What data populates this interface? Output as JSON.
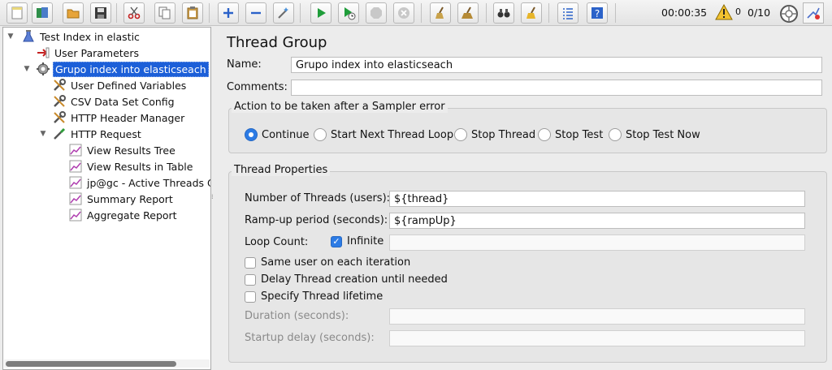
{
  "toolbar": {
    "buttons": [
      "new",
      "templates",
      "open",
      "save",
      "cut",
      "copy",
      "paste",
      "expand",
      "collapse",
      "toggle",
      "start",
      "start-no-pauses",
      "stop",
      "shutdown",
      "clear",
      "clear-all",
      "search",
      "reset-search",
      "function-helper",
      "help"
    ],
    "elapsed_time": "00:00:35",
    "error_count": "0",
    "thread_ratio": "0/10"
  },
  "tree": {
    "nodes": [
      {
        "label": "Test Index in elastic",
        "icon": "flask-icon"
      },
      {
        "label": "User Parameters",
        "icon": "preprocessor-icon"
      },
      {
        "label": "Grupo index into elasticseach",
        "icon": "gear-icon"
      },
      {
        "label": "User Defined Variables",
        "icon": "wrench-icon"
      },
      {
        "label": "CSV Data Set Config",
        "icon": "wrench-icon"
      },
      {
        "label": "HTTP Header Manager",
        "icon": "wrench-icon"
      },
      {
        "label": "HTTP Request",
        "icon": "pipette-icon"
      },
      {
        "label": "View Results Tree",
        "icon": "graph-icon"
      },
      {
        "label": "View Results in Table",
        "icon": "graph-icon"
      },
      {
        "label": "jp@gc - Active Threads Ov",
        "icon": "graph-icon"
      },
      {
        "label": "Summary Report",
        "icon": "graph-icon"
      },
      {
        "label": "Aggregate Report",
        "icon": "graph-icon"
      }
    ]
  },
  "panel": {
    "title": "Thread Group",
    "name_label": "Name:",
    "name_value": "Grupo index into elasticseach",
    "comments_label": "Comments:",
    "comments_value": "",
    "sampler_error": {
      "legend": "Action to be taken after a Sampler error",
      "options": [
        "Continue",
        "Start Next Thread Loop",
        "Stop Thread",
        "Stop Test",
        "Stop Test Now"
      ],
      "selected": "Continue"
    },
    "thread_props": {
      "legend": "Thread Properties",
      "num_threads_label": "Number of Threads (users):",
      "num_threads_value": "${thread}",
      "rampup_label": "Ramp-up period (seconds):",
      "rampup_value": "${rampUp}",
      "loop_label": "Loop Count:",
      "infinite_label": "Infinite",
      "infinite_checked": true,
      "loop_value": "",
      "same_user_label": "Same user on each iteration",
      "delay_label": "Delay Thread creation until needed",
      "lifetime_label": "Specify Thread lifetime",
      "duration_label": "Duration (seconds):",
      "duration_value": "",
      "startup_label": "Startup delay (seconds):",
      "startup_value": ""
    }
  }
}
